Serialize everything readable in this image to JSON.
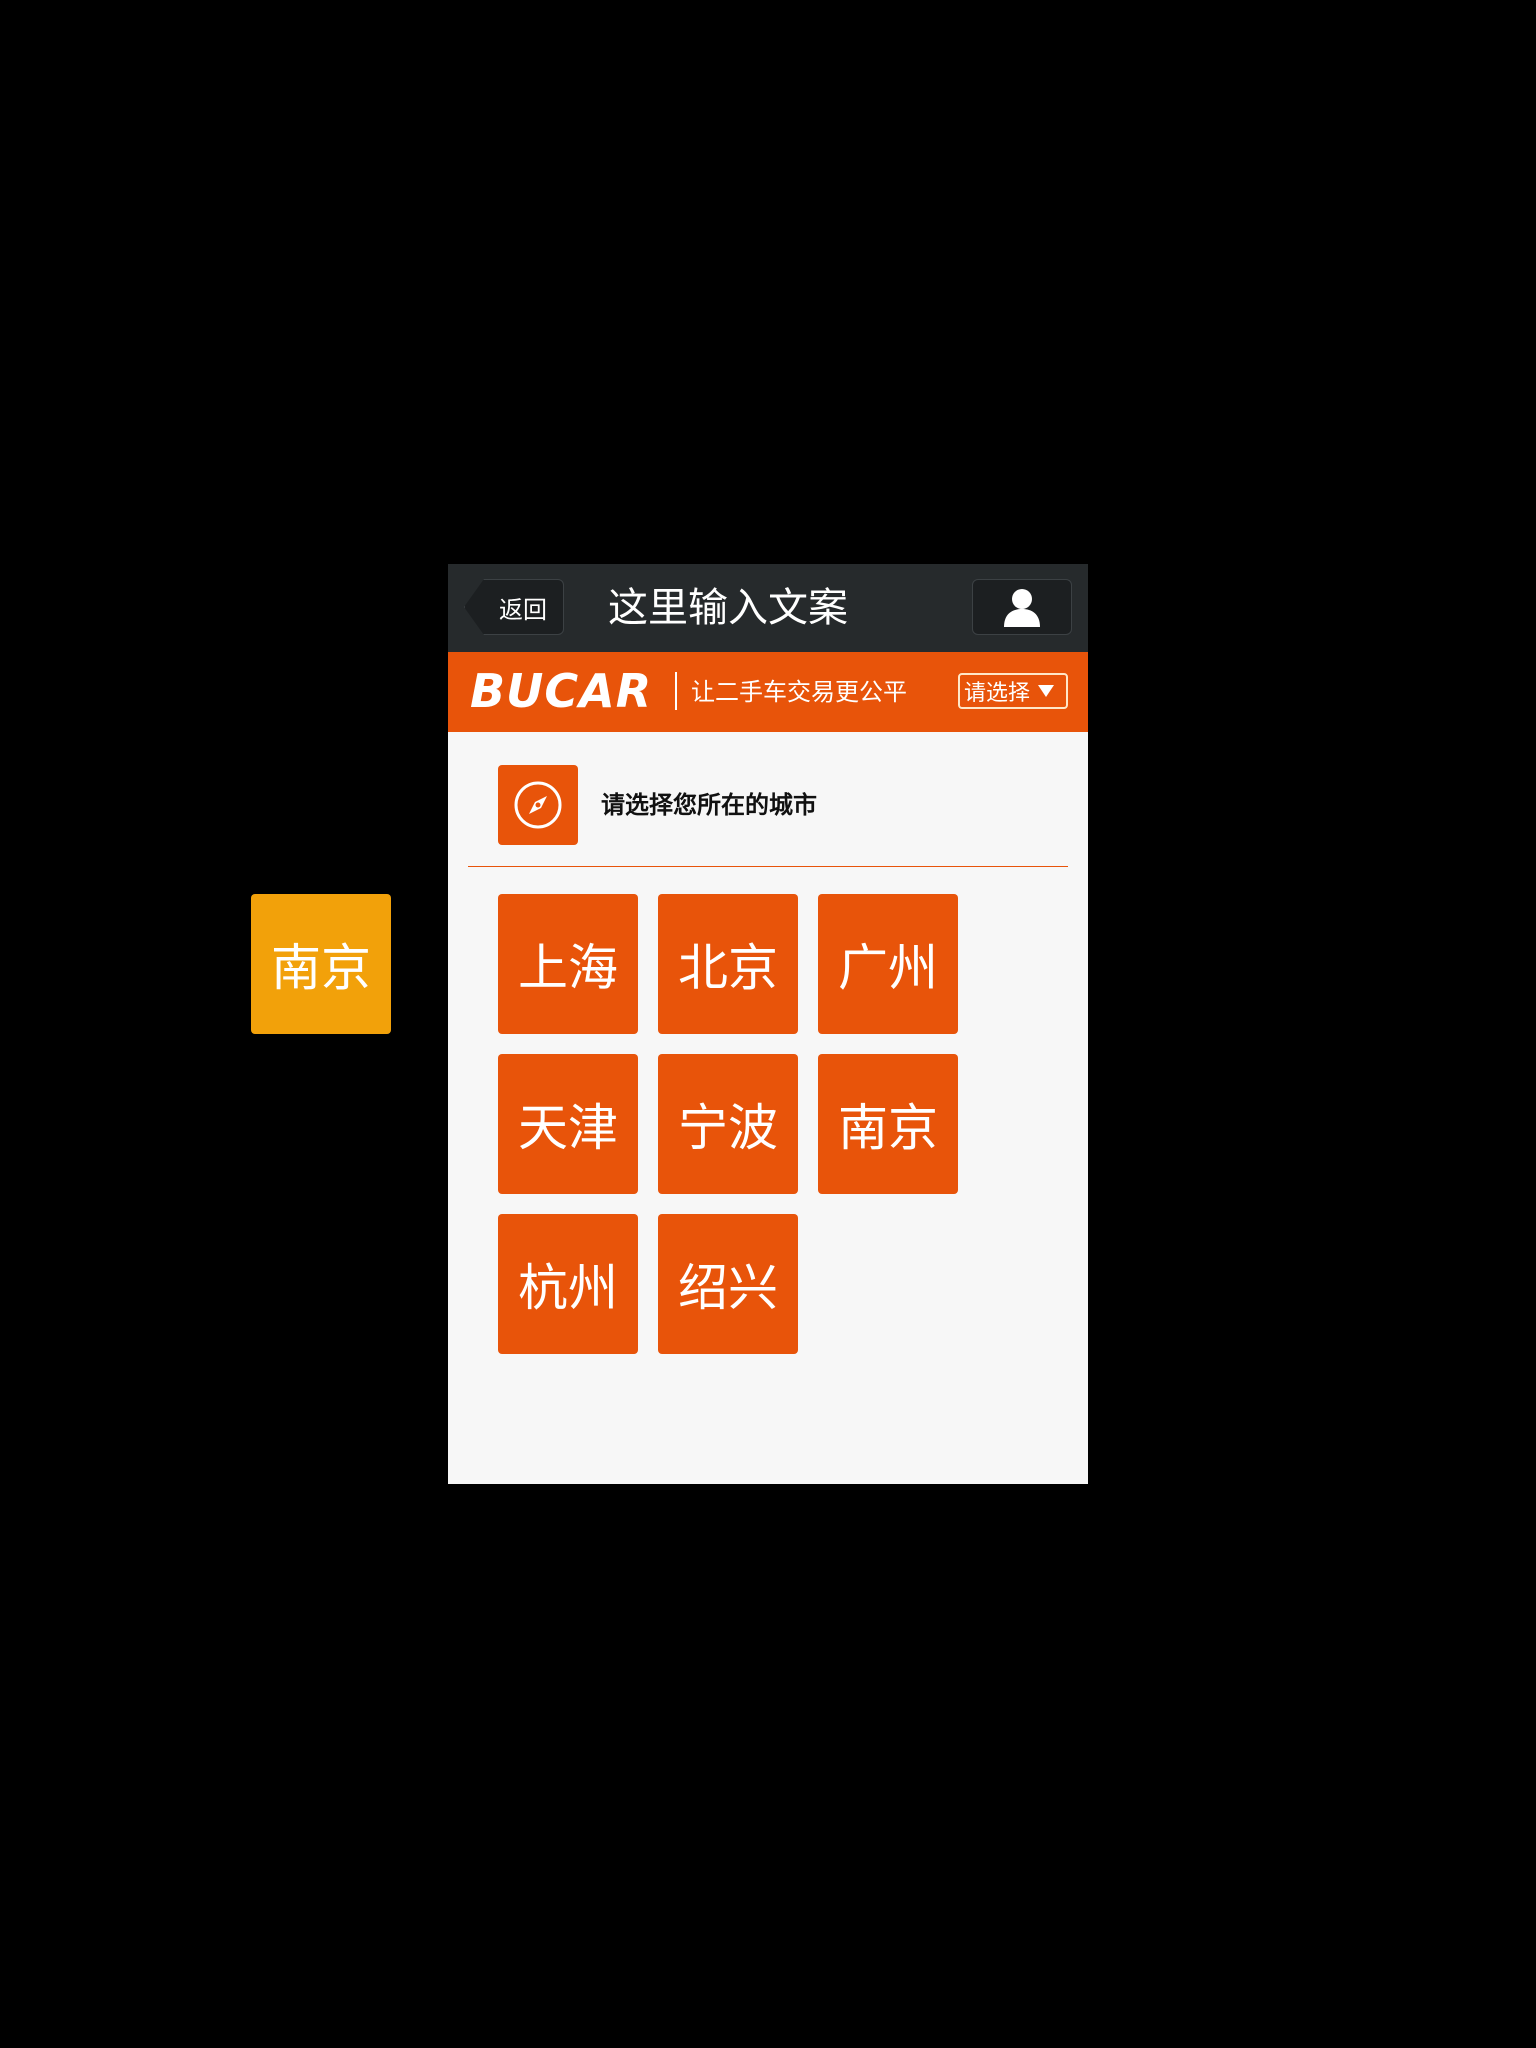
{
  "nav": {
    "back_label": "返回",
    "title": "这里输入文案",
    "user_icon": "user-icon"
  },
  "brand": {
    "logo_text": "BUCAR",
    "slogan": "让二手车交易更公平",
    "select_label": "请选择",
    "color": "#e8540a"
  },
  "prompt": {
    "icon": "compass-icon",
    "text": "请选择您所在的城市"
  },
  "cities": [
    {
      "label": "上海"
    },
    {
      "label": "北京"
    },
    {
      "label": "广州"
    },
    {
      "label": "天津"
    },
    {
      "label": "宁波"
    },
    {
      "label": "南京"
    },
    {
      "label": "杭州"
    },
    {
      "label": "绍兴"
    }
  ],
  "dragged_tile": {
    "label": "南京",
    "color": "#f2a10a"
  }
}
